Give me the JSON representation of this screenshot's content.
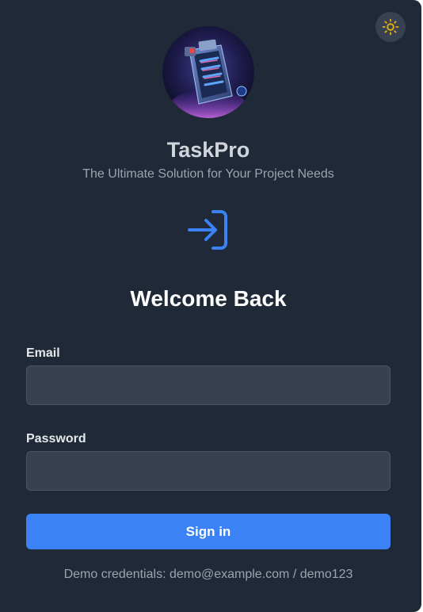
{
  "theme_toggle": {
    "icon": "sun-icon",
    "color": "#eab308"
  },
  "brand": {
    "name": "TaskPro",
    "tagline": "The Ultimate Solution for Your Project Needs",
    "logo_icon": "clipboard-logo"
  },
  "login_icon": {
    "icon": "log-in-icon",
    "color": "#3b82f6"
  },
  "heading": "Welcome Back",
  "form": {
    "email_label": "Email",
    "email_value": "",
    "email_placeholder": "",
    "password_label": "Password",
    "password_value": "",
    "password_placeholder": "",
    "submit_label": "Sign in"
  },
  "demo_note": "Demo credentials: demo@example.com / demo123",
  "colors": {
    "background": "#1f2937",
    "input_background": "#374151",
    "accent": "#3b82f6"
  }
}
